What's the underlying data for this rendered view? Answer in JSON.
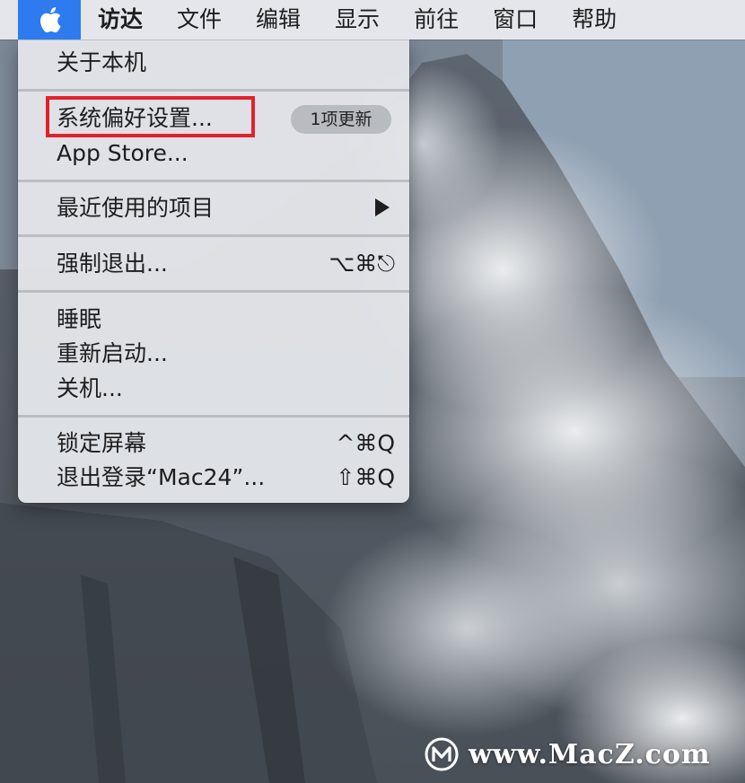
{
  "menubar": {
    "apple_icon": "apple-logo-icon",
    "items": [
      "访达",
      "文件",
      "编辑",
      "显示",
      "前往",
      "窗口",
      "帮助"
    ]
  },
  "apple_menu": {
    "about": "关于本机",
    "system_prefs": "系统偏好设置...",
    "system_prefs_badge": "1项更新",
    "app_store": "App Store...",
    "recent_items": "最近使用的项目",
    "force_quit": "强制退出...",
    "force_quit_shortcut": "⌥⌘⎋",
    "sleep": "睡眠",
    "restart": "重新启动...",
    "shutdown": "关机...",
    "lock_screen": "锁定屏幕",
    "lock_screen_shortcut": "^⌘Q",
    "logout": "退出登录“Mac24”...",
    "logout_shortcut": "⇧⌘Q"
  },
  "annotation": {
    "highlight_color": "#e0232b",
    "highlight_target": "系统偏好设置..."
  },
  "watermark": {
    "text": "www.MacZ.com"
  },
  "colors": {
    "apple_menu_active": "#2e7bef",
    "menu_bg": "#e2e4e8"
  }
}
